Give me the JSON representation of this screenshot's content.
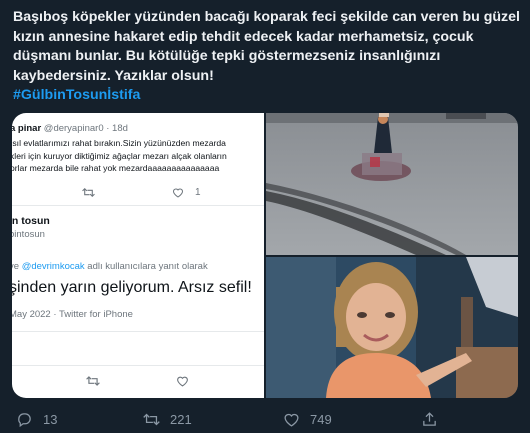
{
  "tweet": {
    "text_lines": [
      "Başıboş köpekler yüzünden bacağı koparak feci şekilde can veren bu güzel",
      "kızın annesine hakaret edip tehdit edecek kadar merhametsiz, çocuk",
      "düşmanı bunlar. Bu kötülüğe tepki göstermezseniz insanlığınızı",
      "kaybedersiniz. Yazıklar olsun!"
    ],
    "hashtag": "#GülbinTosunİstifa"
  },
  "screenshot": {
    "reply_name": "a pinar",
    "reply_handle": "@deryapinar0 · 18d",
    "reply_lines": [
      "ısıl evlatlarımızı rahat bırakın.Sizin yüzünüzden mezarda",
      "kleri için kuruyor diktiğimiz ağaçlar mezarı alçak olanların",
      "orlar mezarda bile rahat yok mezardaaaaaaaaaaaaaaa"
    ],
    "reply_like_count": "1",
    "user_name": "in tosun",
    "user_handle": "bintosun",
    "reply_to_prefix": "ve",
    "reply_to_mention_1": "@devrimkocak",
    "reply_to_suffix": "adlı kullanıcılara yanıt olarak",
    "main_text": "şinden yarın geliyorum. Arsız sefil!",
    "meta": "May 2022 · Twitter for iPhone"
  },
  "actions": {
    "replies": "13",
    "retweets": "221",
    "likes": "749"
  },
  "colors": {
    "background": "#15202b",
    "accent": "#1d9bf0",
    "muted": "#8b98a5"
  }
}
